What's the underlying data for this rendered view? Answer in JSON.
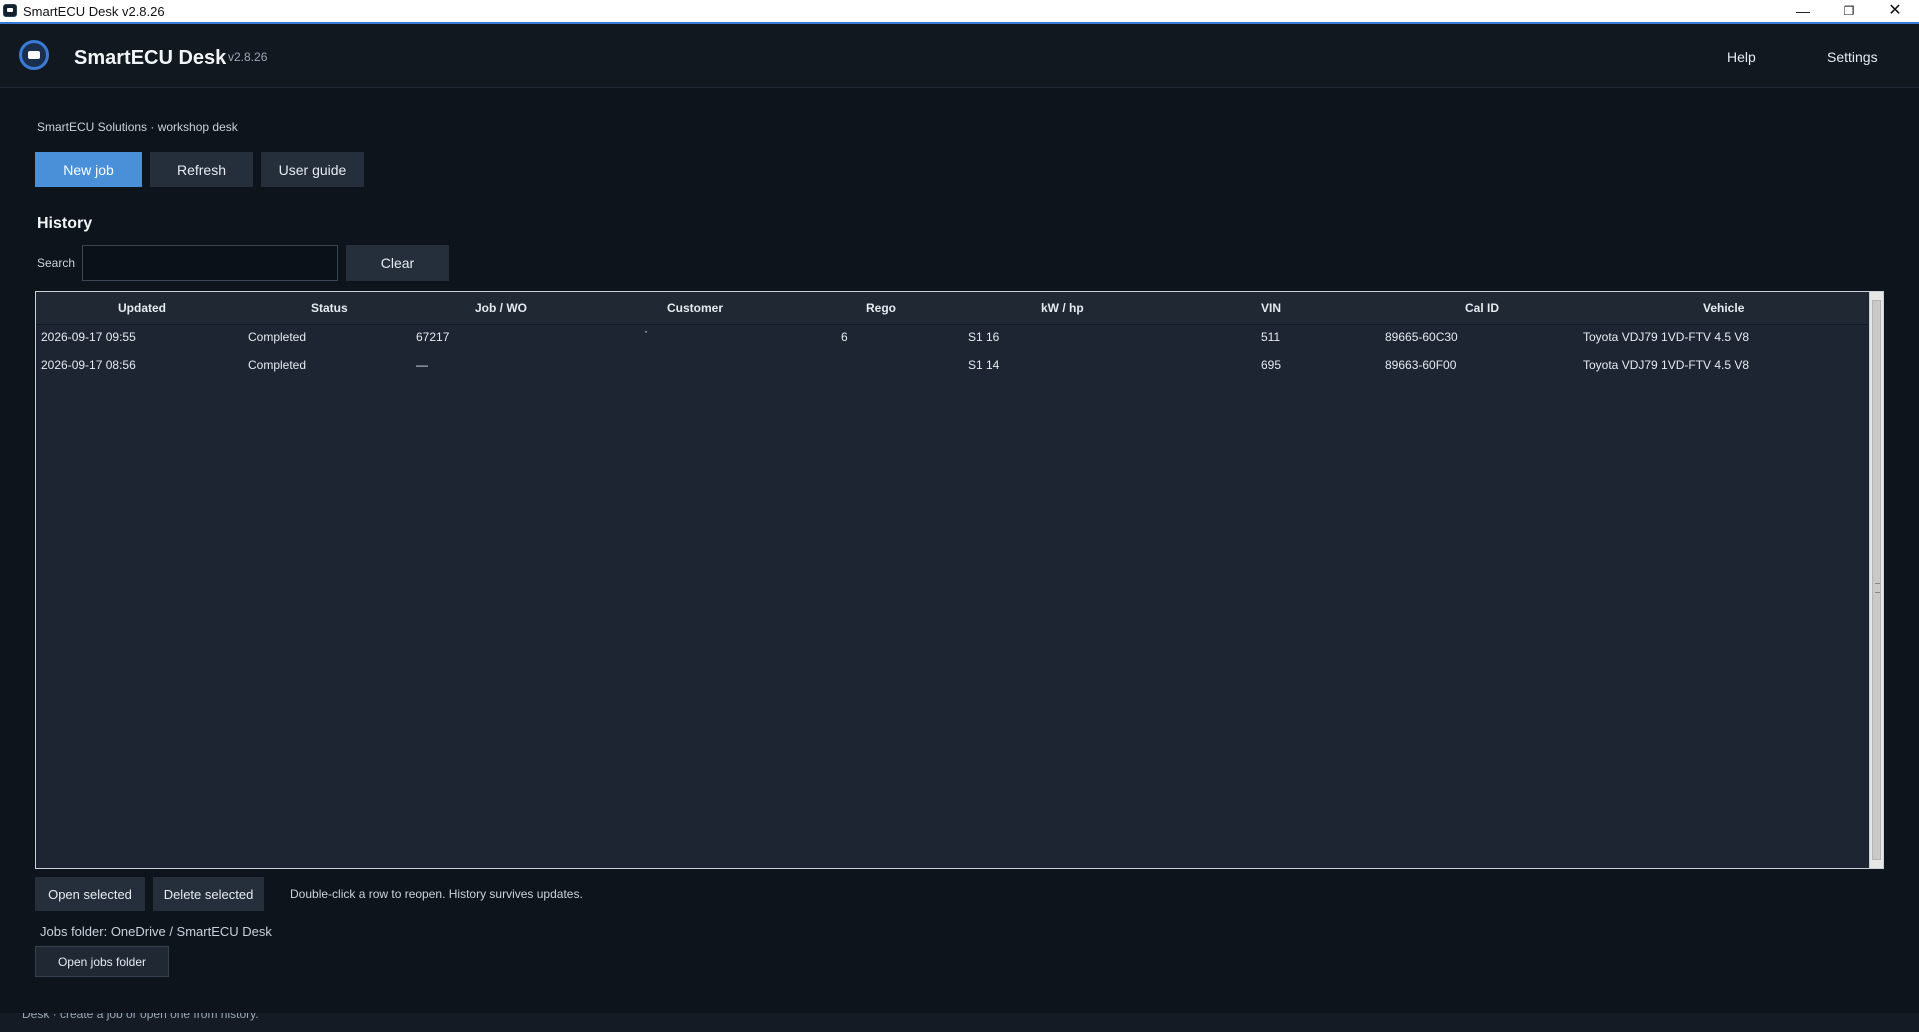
{
  "window": {
    "title": "SmartECU Desk  v2.8.26",
    "minimize": "—",
    "maximize": "❐",
    "close": "✕"
  },
  "header": {
    "app_name": "SmartECU Desk",
    "version": "v2.8.26",
    "help": "Help",
    "settings": "Settings"
  },
  "subtitle": "SmartECU Solutions · workshop desk",
  "actions": {
    "new_job": "New job",
    "refresh": "Refresh",
    "user_guide": "User guide"
  },
  "history": {
    "title": "History",
    "search_label": "Search",
    "search_value": "",
    "clear": "Clear",
    "columns": [
      "Updated",
      "Status",
      "Job / WO",
      "Customer",
      "Rego",
      "kW / hp",
      "VIN",
      "Cal ID",
      "Vehicle"
    ],
    "rows": [
      {
        "updated": "2026-09-17 09:55",
        "status": "Completed",
        "job": "67217",
        "customer": "·",
        "rego": "6",
        "kw": "S1 16",
        "vin": "511",
        "cal": "89665-60C30",
        "vehicle": "Toyota VDJ79 1VD-FTV 4.5 V8"
      },
      {
        "updated": "2026-09-17 08:56",
        "status": "Completed",
        "job": "—",
        "customer": "",
        "rego": "",
        "kw": "S1 14",
        "vin": "695",
        "cal": "89663-60F00",
        "vehicle": "Toyota VDJ79 1VD-FTV 4.5 V8"
      }
    ]
  },
  "footer": {
    "open_selected": "Open selected",
    "delete_selected": "Delete selected",
    "hint": "Double-click a row to reopen. History survives updates.",
    "jobs_folder": "Jobs folder: OneDrive / SmartECU Desk",
    "open_jobs_folder": "Open jobs folder"
  },
  "status_bar": "Desk · create a job or open one from history."
}
